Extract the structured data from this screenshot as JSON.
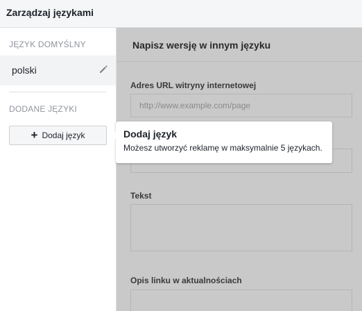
{
  "header": {
    "title": "Zarządzaj językami"
  },
  "sidebar": {
    "default_section_title": "JĘZYK DOMYŚLNY",
    "default_language": "polski",
    "added_section_title": "DODANE JĘZYKI",
    "add_button_label": "Dodaj język"
  },
  "main": {
    "title": "Napisz wersję w innym języku",
    "fields": {
      "url_label": "Adres URL witryny internetowej",
      "url_placeholder": "http://www.example.com/page",
      "text_label": "Tekst",
      "news_label": "Opis linku w aktualnościach"
    }
  },
  "tooltip": {
    "title": "Dodaj język",
    "text": "Możesz utworzyć reklamę w maksymalnie 5 językach."
  },
  "icons": {
    "edit": "pencil-icon",
    "add": "plus-icon"
  },
  "colors": {
    "overlay": "#c9c9c9",
    "header_bg": "#f5f6f7",
    "selected_row": "#f2f3f5"
  }
}
